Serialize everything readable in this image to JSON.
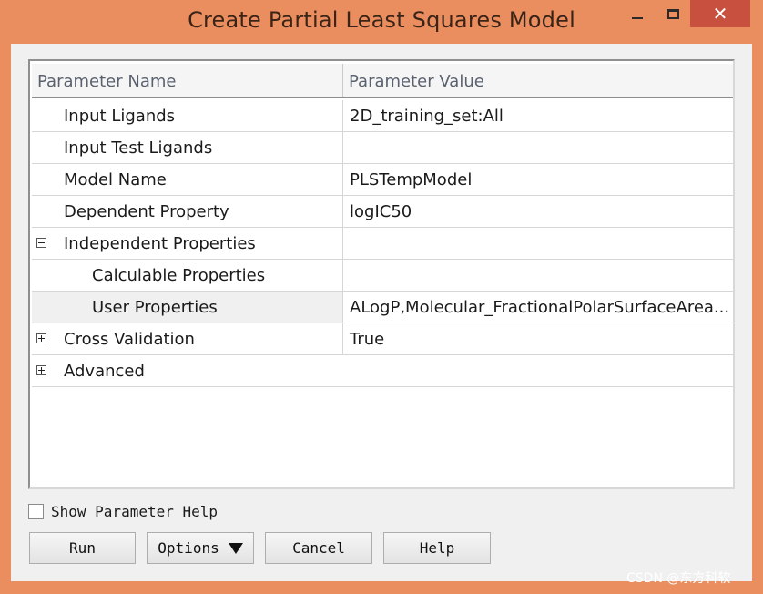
{
  "window": {
    "title": "Create Partial Least Squares Model",
    "close_glyph": "✕"
  },
  "grid": {
    "headers": {
      "name": "Parameter Name",
      "value": "Parameter Value"
    },
    "rows": [
      {
        "name": "Input Ligands",
        "value": "2D_training_set:All"
      },
      {
        "name": "Input Test Ligands",
        "value": ""
      },
      {
        "name": "Model Name",
        "value": "PLSTempModel"
      },
      {
        "name": "Dependent Property",
        "value": "logIC50"
      },
      {
        "name": "Independent Properties",
        "value": "",
        "expander": "collapse"
      },
      {
        "name": "Calculable Properties",
        "value": ""
      },
      {
        "name": "User Properties",
        "value": "ALogP,Molecular_FractionalPolarSurfaceArea...",
        "selected": true
      },
      {
        "name": "Cross Validation",
        "value": "True",
        "expander": "expand"
      },
      {
        "name": "Advanced",
        "value": "",
        "expander": "expand"
      }
    ]
  },
  "help_checkbox": {
    "label": "Show Parameter Help",
    "checked": false
  },
  "buttons": {
    "run": "Run",
    "options": "Options",
    "cancel": "Cancel",
    "help": "Help"
  },
  "watermark": "CSDN @东方科软",
  "colors": {
    "title_bar": "#eb8e5f",
    "close_button": "#c7503f",
    "client": "#f0f0f0"
  },
  "icons": {
    "minimize": "minimize-icon",
    "maximize": "maximize-icon",
    "close": "close-icon",
    "collapse": "minus-box-icon",
    "expand": "plus-box-icon",
    "dropdown": "triangle-down-icon"
  }
}
